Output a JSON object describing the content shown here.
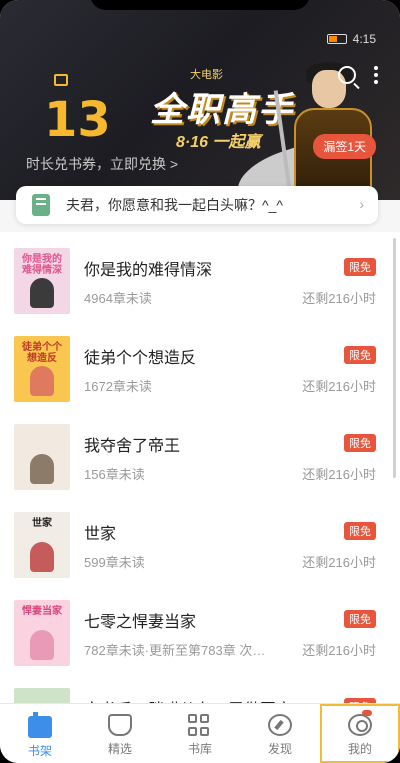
{
  "status_bar": {
    "left": "",
    "time": "4:15"
  },
  "banner": {
    "number": "13",
    "title": "全职高手",
    "small_text": "大电影",
    "date_text": "8·16 一起赢",
    "link_text": "时长兑书券，立即兑换 >",
    "sign_badge": "漏签1天"
  },
  "notice": {
    "text": "夫君，你愿意和我一起白头嘛？^_^",
    "arrow": "›"
  },
  "books": [
    {
      "title": "你是我的难得情深",
      "sub": "4964章未读",
      "tag": "限免",
      "remain": "还剩216小时",
      "cover_text": "你是我的难得情深",
      "cover_bg": "#f4d7e6",
      "cover_color": "#e0568c",
      "fig_color": "#3b3b3b"
    },
    {
      "title": "徒弟个个想造反",
      "sub": "1672章未读",
      "tag": "限免",
      "remain": "还剩216小时",
      "cover_text": "徒弟个个想造反",
      "cover_bg": "#f9c74f",
      "cover_color": "#c0392b",
      "fig_color": "#e07a5f"
    },
    {
      "title": "我夺舍了帝王",
      "sub": "156章未读",
      "tag": "限免",
      "remain": "还剩216小时",
      "cover_text": "",
      "cover_bg": "#f2e9e1",
      "cover_color": "#333",
      "fig_color": "#8d7b6a"
    },
    {
      "title": "世家",
      "sub": "599章未读",
      "tag": "限免",
      "remain": "还剩216小时",
      "cover_text": "世家",
      "cover_bg": "#f1ece6",
      "cover_color": "#222",
      "fig_color": "#c65b5b"
    },
    {
      "title": "七零之悍妻当家",
      "sub": "782章未读·更新至第783章 次…",
      "tag": "限免",
      "remain": "还剩216小时",
      "cover_text": "悍妻当家",
      "cover_bg": "#fbd3e0",
      "cover_color": "#d9467e",
      "fig_color": "#e89ab6"
    },
    {
      "title": "穿书后，胖喵儿在八零做团宠",
      "sub": "",
      "tag": "限免",
      "remain": "",
      "cover_text": "",
      "cover_bg": "#cfe3c8",
      "cover_color": "#333",
      "fig_color": "#8bb07f"
    }
  ],
  "tabs": [
    {
      "label": "书架",
      "icon": "bookshelf-icon"
    },
    {
      "label": "精选",
      "icon": "diamond-icon"
    },
    {
      "label": "书库",
      "icon": "grid-icon"
    },
    {
      "label": "发现",
      "icon": "compass-icon"
    },
    {
      "label": "我的",
      "icon": "user-icon"
    }
  ],
  "colors": {
    "accent": "#3c8ee8",
    "tag": "#e8553d",
    "highlight": "#f1bb3a"
  }
}
